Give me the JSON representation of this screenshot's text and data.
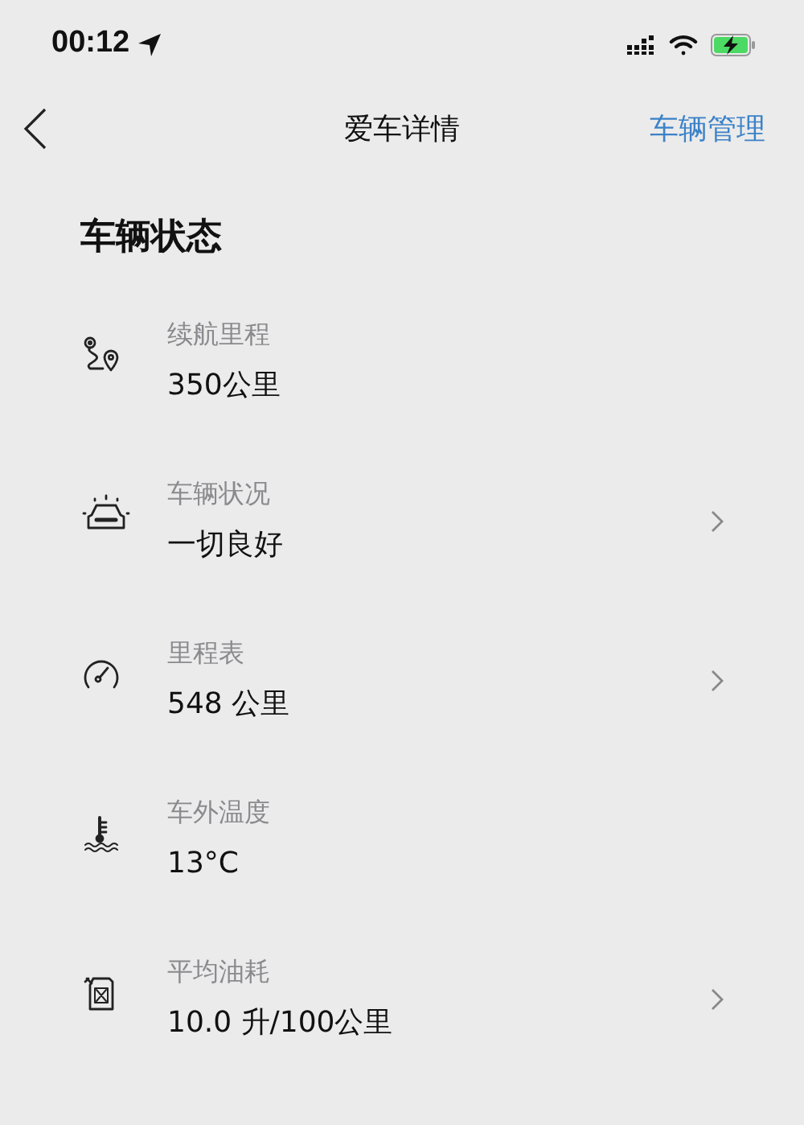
{
  "status_bar": {
    "time": "00:12"
  },
  "nav": {
    "title": "爱车详情",
    "action": "车辆管理"
  },
  "section": {
    "title": "车辆状态"
  },
  "rows": [
    {
      "kind": "route",
      "label": "续航里程",
      "value": "350公里",
      "chevron": false
    },
    {
      "kind": "car",
      "label": "车辆状况",
      "value": "一切良好",
      "chevron": true
    },
    {
      "kind": "gauge",
      "label": "里程表",
      "value": "548 公里",
      "chevron": true
    },
    {
      "kind": "thermometer",
      "label": "车外温度",
      "value": "13°C",
      "chevron": false
    },
    {
      "kind": "fuel",
      "label": "平均油耗",
      "value": "10.0 升/100公里",
      "chevron": true
    }
  ]
}
